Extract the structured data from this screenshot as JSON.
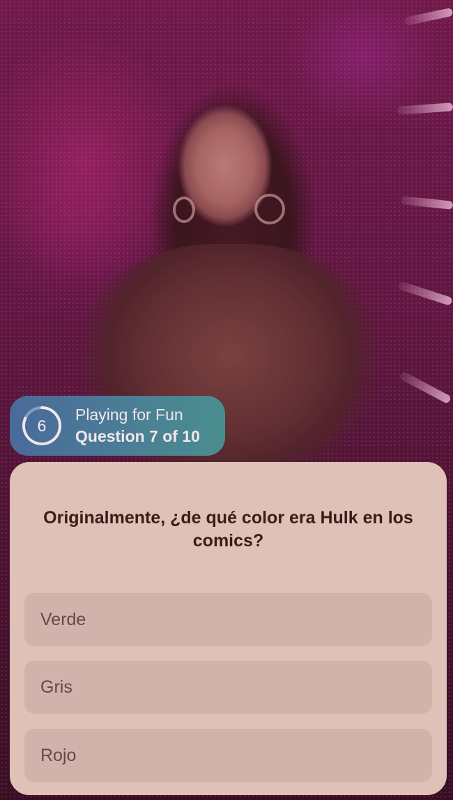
{
  "status": {
    "timer_value": "6",
    "mode_label": "Playing for Fun",
    "progress_label": "Question 7 of 10",
    "question_number": 7,
    "question_total": 10
  },
  "question": {
    "text": "Originalmente, ¿de qué color era Hulk en los comics?"
  },
  "options": [
    {
      "label": "Verde"
    },
    {
      "label": "Gris"
    },
    {
      "label": "Rojo"
    }
  ],
  "colors": {
    "card_bg": "#dfc1b8",
    "option_bg": "#d1b3ab",
    "question_text": "#3b1c18",
    "option_text": "#6b4744",
    "pill_gradient_start": "#4a6a9a",
    "pill_gradient_end": "#4a8e8e"
  }
}
